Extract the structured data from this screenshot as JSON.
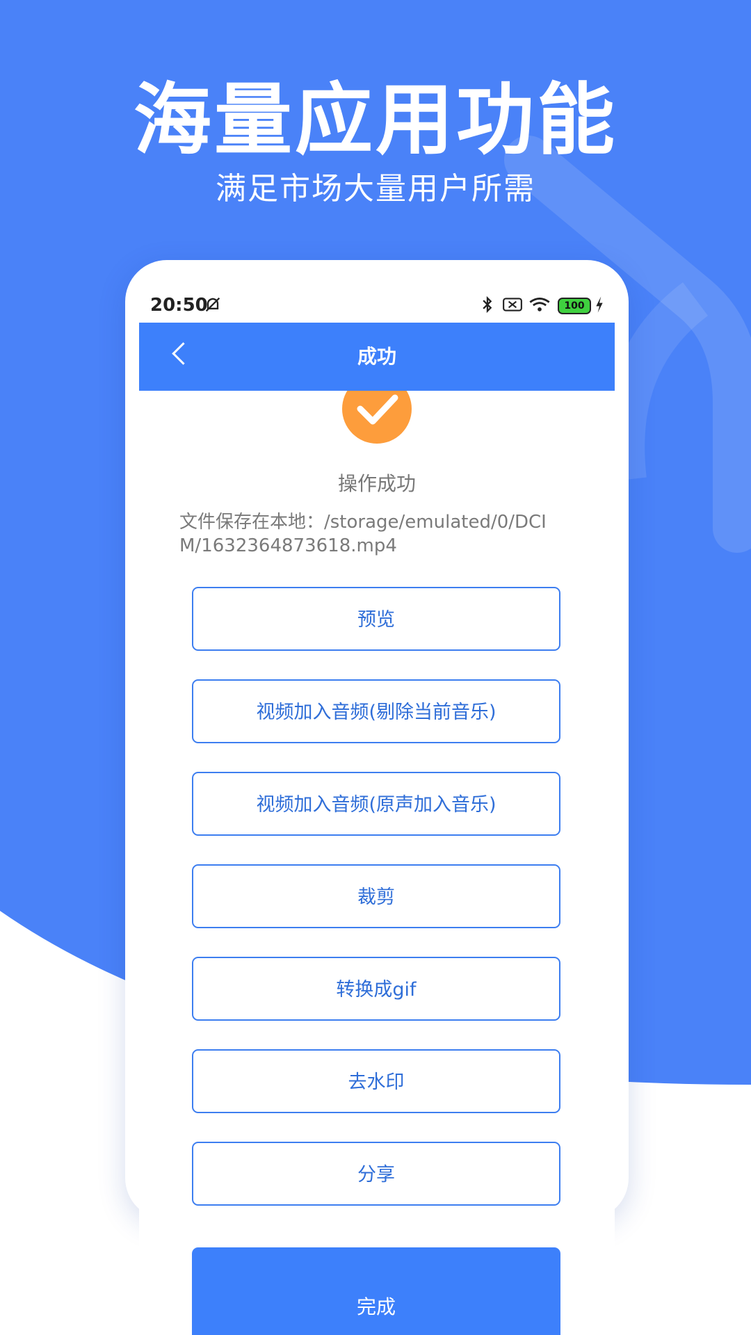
{
  "promo": {
    "title": "海量应用功能",
    "subtitle": "满足市场大量用户所需"
  },
  "status_bar": {
    "time": "20:50",
    "battery": "100"
  },
  "app_bar": {
    "title": "成功"
  },
  "result": {
    "message": "操作成功",
    "file_path": "文件保存在本地：/storage/emulated/0/DCIM/1632364873618.mp4"
  },
  "actions": [
    {
      "label": "预览"
    },
    {
      "label": "视频加入音频(剔除当前音乐)"
    },
    {
      "label": "视频加入音频(原声加入音乐)"
    },
    {
      "label": "裁剪"
    },
    {
      "label": "转换成gif"
    },
    {
      "label": "去水印"
    },
    {
      "label": "分享"
    }
  ],
  "done_button": {
    "label": "完成"
  },
  "colors": {
    "background_blue": "#4a82f8",
    "primary_blue": "#3d80fb",
    "success_orange": "#fd9d3c",
    "button_text": "#2f6ed8"
  },
  "icons": {
    "back": "chevron-left-icon",
    "success": "check-icon",
    "mute": "bell-off-icon",
    "bluetooth": "bluetooth-icon",
    "sim": "no-sim-icon",
    "wifi": "wifi-icon",
    "charging": "lightning-icon"
  }
}
